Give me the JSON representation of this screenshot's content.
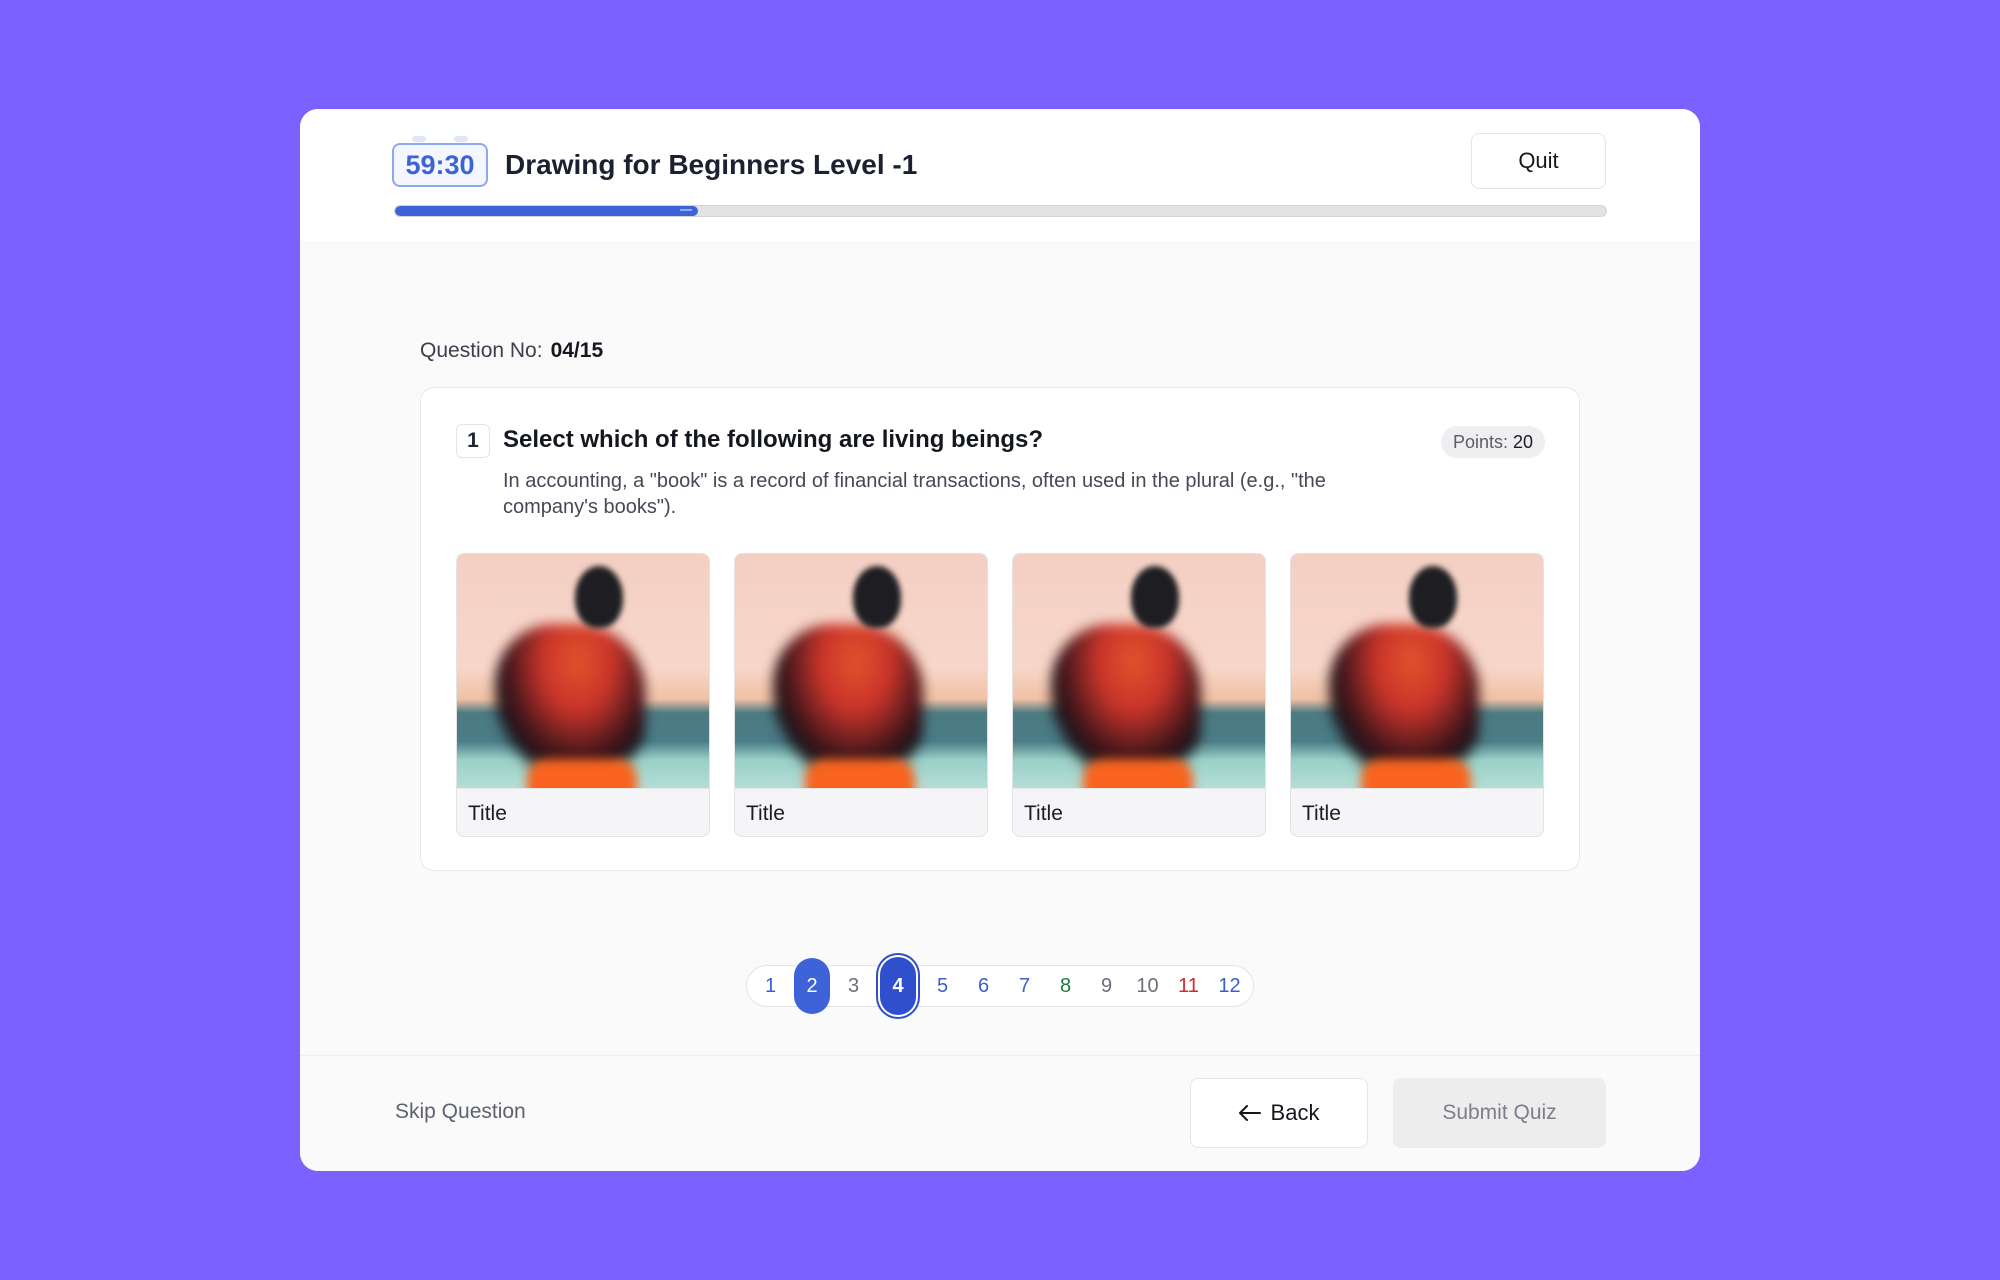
{
  "header": {
    "timer": "59:30",
    "title": "Drawing for Beginners Level -1",
    "quit_label": "Quit",
    "progress_fraction": 0.25
  },
  "question": {
    "number_label": "Question No:",
    "number_value": "04/15",
    "index": "1",
    "title": "Select which of the following are living beings?",
    "points_label": "Points:",
    "points_value": "20",
    "description": "In accounting, a \"book\" is a record of financial transactions, often used in the plural (e.g., \"the company's books\").",
    "options": [
      {
        "label": "Title"
      },
      {
        "label": "Title"
      },
      {
        "label": "Title"
      },
      {
        "label": "Title"
      }
    ]
  },
  "pagination": {
    "pages": [
      {
        "label": "1",
        "state": "default"
      },
      {
        "label": "2",
        "state": "answered"
      },
      {
        "label": "3",
        "state": "grey"
      },
      {
        "label": "4",
        "state": "current"
      },
      {
        "label": "5",
        "state": "default"
      },
      {
        "label": "6",
        "state": "default"
      },
      {
        "label": "7",
        "state": "default"
      },
      {
        "label": "8",
        "state": "green"
      },
      {
        "label": "9",
        "state": "grey"
      },
      {
        "label": "10",
        "state": "grey"
      },
      {
        "label": "11",
        "state": "red"
      },
      {
        "label": "12",
        "state": "default"
      }
    ]
  },
  "footer": {
    "skip_label": "Skip Question",
    "back_label": "Back",
    "submit_label": "Submit Quiz"
  },
  "colors": {
    "background": "#7b61ff",
    "accent": "#3e63d9",
    "current": "#2f4fcd",
    "correct": "#1e7a3a",
    "wrong": "#d12a2a"
  }
}
